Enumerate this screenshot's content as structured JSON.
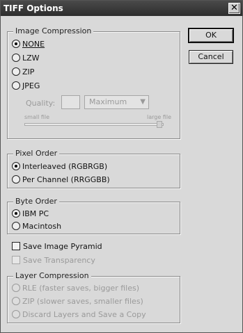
{
  "dialog": {
    "title": "TIFF Options",
    "close_glyph": "✕"
  },
  "buttons": {
    "ok": "OK",
    "cancel": "Cancel"
  },
  "image_compression": {
    "legend": "Image Compression",
    "options": [
      "NONE",
      "LZW",
      "ZIP",
      "JPEG"
    ],
    "selected": "NONE",
    "quality_label": "Quality:",
    "quality_value": "",
    "quality_select": "Maximum",
    "small_file_label": "small file",
    "large_file_label": "large file"
  },
  "pixel_order": {
    "legend": "Pixel Order",
    "options": [
      "Interleaved (RGBRGB)",
      "Per Channel (RRGGBB)"
    ],
    "selected": "Interleaved (RGBRGB)"
  },
  "byte_order": {
    "legend": "Byte Order",
    "options": [
      "IBM PC",
      "Macintosh"
    ],
    "selected": "IBM PC"
  },
  "checks": {
    "save_pyramid": "Save Image Pyramid",
    "save_transparency": "Save Transparency"
  },
  "layer_compression": {
    "legend": "Layer Compression",
    "options": [
      "RLE (faster saves, bigger files)",
      "ZIP (slower saves, smaller files)",
      "Discard Layers and Save a Copy"
    ]
  }
}
